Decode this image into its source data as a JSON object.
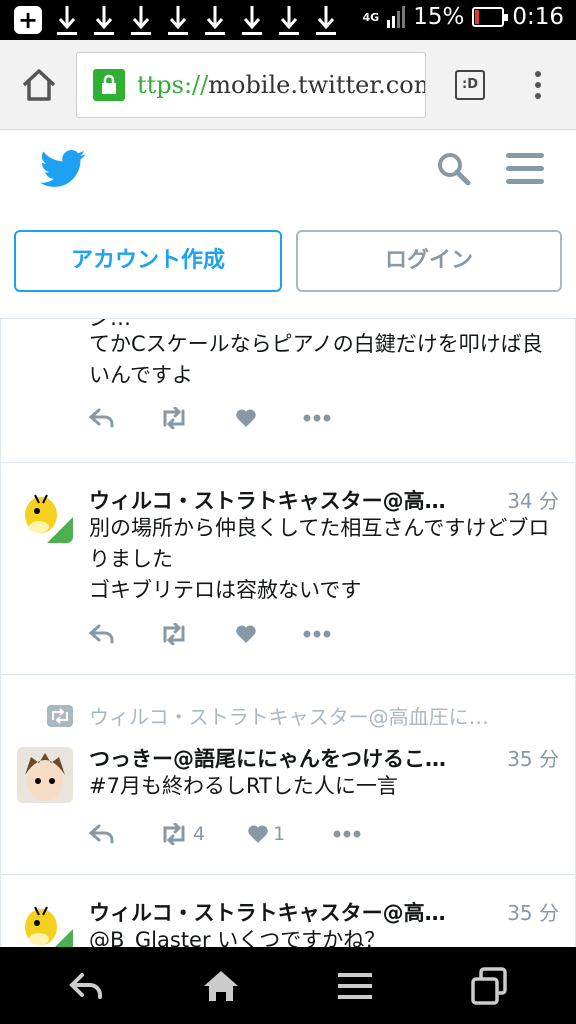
{
  "status_bar": {
    "network": "4G",
    "battery_percent": "15%",
    "battery_level": 0.15,
    "time": "0:16",
    "download_icons": 8
  },
  "browser": {
    "url_scheme": "ttps://",
    "url_host": "mobile.twitter.com/",
    "tabs_label": ":D"
  },
  "twitter": {
    "signup_label": "アカウント作成",
    "login_label": "ログイン",
    "brand_color": "#1da1f2"
  },
  "tweets": [
    {
      "partial_top": "ジ…",
      "text": "てかCスケールならピアノの白鍵だけを叩けば良いんですよ",
      "retweets": "",
      "likes": ""
    },
    {
      "name": "ウィルコ・ストラトキャスター@高…",
      "time": "34 分",
      "text": "別の場所から仲良くしてた相互さんですけどブロりました\nゴキブリテロは容赦ないです",
      "retweets": "",
      "likes": ""
    },
    {
      "retweeted_by": "ウィルコ・ストラトキャスター@高血圧に…",
      "name": "つっきー@語尾ににゃんをつけるこ…",
      "time": "35 分",
      "text": "#7月も終わるしRTした人に一言",
      "retweets": "4",
      "likes": "1"
    },
    {
      "name": "ウィルコ・ストラトキャスター@高…",
      "time": "35 分",
      "text": "@B_Glaster いくつですかね？"
    }
  ]
}
